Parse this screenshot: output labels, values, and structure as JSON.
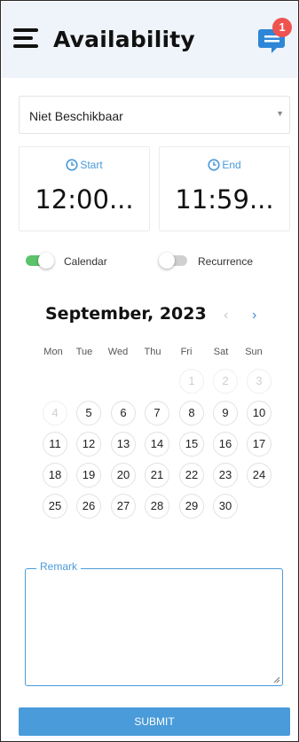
{
  "header": {
    "title": "Availability",
    "chat_badge_count": "1"
  },
  "status_select": {
    "value": "Niet Beschikbaar"
  },
  "time": {
    "start_label": "Start",
    "start_value": "12:00...",
    "end_label": "End",
    "end_value": "11:59..."
  },
  "toggles": {
    "calendar_label": "Calendar",
    "calendar_on": true,
    "recurrence_label": "Recurrence",
    "recurrence_on": false
  },
  "calendar": {
    "month_title": "September, 2023",
    "prev_symbol": "‹",
    "next_symbol": "›",
    "weekdays": [
      "Mon",
      "Tue",
      "Wed",
      "Thu",
      "Fri",
      "Sat",
      "Sun"
    ],
    "days": [
      {
        "label": "1",
        "muted": true
      },
      {
        "label": "2",
        "muted": true
      },
      {
        "label": "3",
        "muted": true
      },
      {
        "label": "4",
        "muted": true
      },
      {
        "label": "5",
        "muted": false
      },
      {
        "label": "6",
        "muted": false
      },
      {
        "label": "7",
        "muted": false
      },
      {
        "label": "8",
        "muted": false
      },
      {
        "label": "9",
        "muted": false
      },
      {
        "label": "10",
        "muted": false
      },
      {
        "label": "11",
        "muted": false
      },
      {
        "label": "12",
        "muted": false
      },
      {
        "label": "13",
        "muted": false
      },
      {
        "label": "14",
        "muted": false
      },
      {
        "label": "15",
        "muted": false
      },
      {
        "label": "16",
        "muted": false
      },
      {
        "label": "17",
        "muted": false
      },
      {
        "label": "18",
        "muted": false
      },
      {
        "label": "19",
        "muted": false
      },
      {
        "label": "20",
        "muted": false
      },
      {
        "label": "21",
        "muted": false
      },
      {
        "label": "22",
        "muted": false
      },
      {
        "label": "23",
        "muted": false
      },
      {
        "label": "24",
        "muted": false
      },
      {
        "label": "25",
        "muted": false
      },
      {
        "label": "26",
        "muted": false
      },
      {
        "label": "27",
        "muted": false
      },
      {
        "label": "28",
        "muted": false
      },
      {
        "label": "29",
        "muted": false
      },
      {
        "label": "30",
        "muted": false
      }
    ]
  },
  "remark": {
    "label": "Remark",
    "value": ""
  },
  "submit_label": "SUBMIT",
  "colors": {
    "accent": "#4a9bd9",
    "toggle_on": "#5cc36a",
    "toggle_off": "#d0d0d0",
    "badge": "#ef5350",
    "header_bg": "#eef4f9"
  },
  "icons": {
    "menu": "menu-icon",
    "chat": "chat-icon",
    "clock": "clock-icon",
    "dropdown": "chevron-down-icon"
  }
}
